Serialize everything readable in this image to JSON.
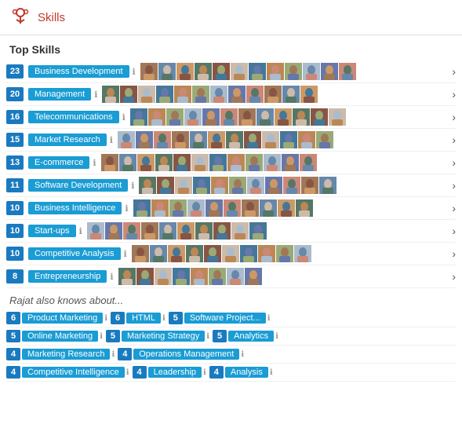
{
  "header": {
    "title": "Skills"
  },
  "top_skills": {
    "label": "Top Skills",
    "skills": [
      {
        "count": "23",
        "name": "Business Development"
      },
      {
        "count": "20",
        "name": "Management"
      },
      {
        "count": "16",
        "name": "Telecommunications"
      },
      {
        "count": "15",
        "name": "Market Research"
      },
      {
        "count": "13",
        "name": "E-commerce"
      },
      {
        "count": "11",
        "name": "Software Development"
      },
      {
        "count": "10",
        "name": "Business Intelligence"
      },
      {
        "count": "10",
        "name": "Start-ups"
      },
      {
        "count": "10",
        "name": "Competitive Analysis"
      },
      {
        "count": "8",
        "name": "Entrepreneurship"
      }
    ]
  },
  "also_knows": {
    "label": "Rajat also knows about...",
    "rows": [
      [
        {
          "count": "6",
          "name": "Product Marketing"
        },
        {
          "count": "6",
          "name": "HTML"
        },
        {
          "count": "5",
          "name": "Software Project..."
        }
      ],
      [
        {
          "count": "5",
          "name": "Online Marketing"
        },
        {
          "count": "5",
          "name": "Marketing Strategy"
        },
        {
          "count": "5",
          "name": "Analytics"
        }
      ],
      [
        {
          "count": "4",
          "name": "Marketing Research"
        },
        {
          "count": "4",
          "name": "Operations Management"
        }
      ],
      [
        {
          "count": "4",
          "name": "Competitive Intelligence"
        },
        {
          "count": "4",
          "name": "Leadership"
        },
        {
          "count": "4",
          "name": "Analysis"
        }
      ]
    ]
  },
  "avatar_colors": [
    "#a07858",
    "#6688aa",
    "#cc9966",
    "#557766",
    "#885544",
    "#ccbbaa",
    "#447799",
    "#bb8855",
    "#997755",
    "#aabbcc",
    "#6677aa",
    "#cc8877"
  ]
}
